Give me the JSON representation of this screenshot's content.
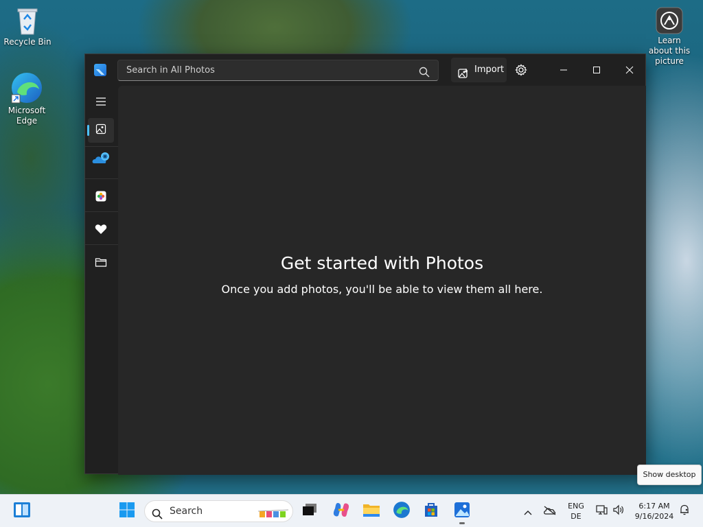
{
  "desktop": {
    "icons": [
      {
        "label": "Recycle Bin"
      },
      {
        "label": "Microsoft Edge"
      },
      {
        "label": "Learn about this picture"
      }
    ]
  },
  "window": {
    "search_placeholder": "Search in All Photos",
    "import_label": "Import",
    "empty_title": "Get started with Photos",
    "empty_subtitle": "Once you add photos, you'll be able to view them all here."
  },
  "sidebar": {
    "items": [
      {
        "icon": "menu-icon"
      },
      {
        "icon": "all-photos-icon",
        "active": true
      },
      {
        "icon": "onedrive-icon"
      },
      {
        "icon": "icloud-photos-icon"
      },
      {
        "icon": "favorites-heart-icon"
      },
      {
        "icon": "folders-icon"
      }
    ]
  },
  "tooltip": {
    "text": "Show desktop"
  },
  "taskbar": {
    "search_label": "Search",
    "lang_top": "ENG",
    "lang_bottom": "DE",
    "time": "6:17 AM",
    "date": "9/16/2024"
  },
  "colors": {
    "accent": "#4cc2ff",
    "window_bg": "#202020",
    "content_bg": "#272727",
    "taskbar_bg": "#eef2f7"
  }
}
